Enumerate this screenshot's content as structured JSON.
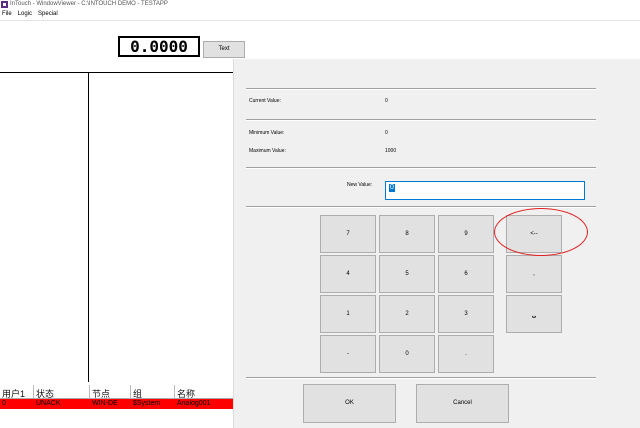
{
  "window": {
    "title": "InTouch - WindowViewer - C:\\INTOUCH DEMO - TESTAPP"
  },
  "menu": {
    "items": [
      "File",
      "Logic",
      "Special"
    ]
  },
  "display": {
    "value": "0.0000",
    "text_button": "Text"
  },
  "alarm_table": {
    "headers": [
      "用户1",
      "状态",
      "节点",
      "组",
      "名称"
    ],
    "row": [
      "0",
      "UNACK",
      "WIN-DE",
      "$System",
      "Analog001"
    ],
    "row_color": "#ff0000"
  },
  "keypad": {
    "current_value_label": "Current Value:",
    "current_value": "0",
    "min_label": "Minimum Value:",
    "min_value": "0",
    "max_label": "Maximum Value:",
    "max_value": "1000",
    "new_value_label": "New Value:",
    "new_value": "0",
    "keys": [
      "7",
      "8",
      "9",
      "<--",
      "4",
      "5",
      "6",
      ",",
      "1",
      "2",
      "3",
      "⎵",
      "-",
      "0",
      "."
    ],
    "ok_label": "OK",
    "cancel_label": "Cancel"
  },
  "colors": {
    "accent": "#0078d7",
    "highlight": "#e02020"
  }
}
